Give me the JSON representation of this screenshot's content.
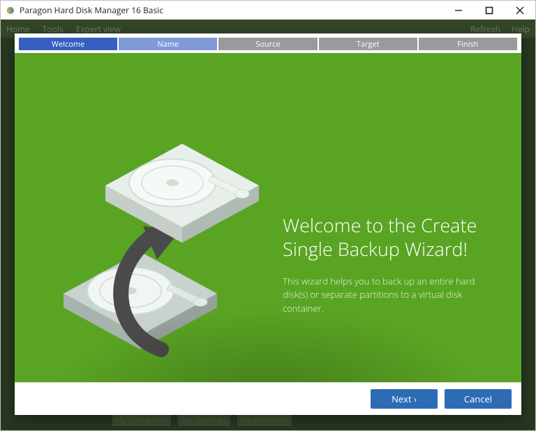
{
  "window": {
    "title": "Paragon Hard Disk Manager 16 Basic"
  },
  "background": {
    "menu": {
      "home": "Home",
      "tools": "Tools",
      "expert": "Expert view",
      "refresh": "Refresh",
      "help": "Help"
    },
    "bottom": {
      "computer": "My Computer",
      "backups": "My Backups",
      "activities": "My Activities"
    }
  },
  "wizard": {
    "steps": {
      "welcome": "Welcome",
      "name": "Name",
      "source": "Source",
      "target": "Target",
      "finish": "Finish"
    },
    "heading": "Welcome to the Create Single Backup Wizard!",
    "description": "This wizard helps you to back up an entire hard disk(s) or separate partitions to a virtual disk container.",
    "buttons": {
      "next": "Next ›",
      "cancel": "Cancel"
    }
  }
}
